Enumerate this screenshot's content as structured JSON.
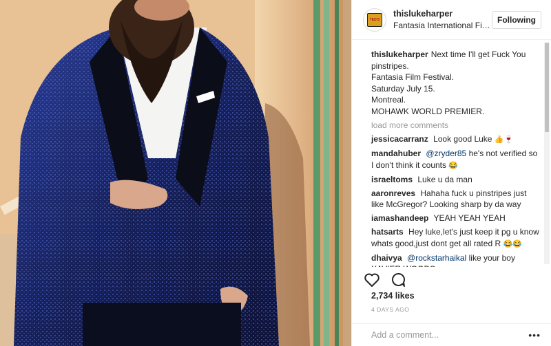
{
  "header": {
    "username": "thislukeharper",
    "location": "Fantasia International Film Festival",
    "follow_label": "Following",
    "avatar_text": "TED'S"
  },
  "caption": {
    "user": "thislukeharper",
    "lines": [
      "Next time I'll get Fuck You",
      "pinstripes.",
      "Fantasia Film Festival.",
      "Saturday July 15.",
      "Montreal.",
      "MOHAWK WORLD PREMIER."
    ]
  },
  "load_more": "load more comments",
  "comments": [
    {
      "user": "jessicacarranz",
      "mention": "",
      "text": "Look good Luke",
      "emoji": "👍🍷"
    },
    {
      "user": "mandahuber",
      "mention": "@zryder85",
      "text": "he's not verified so I don't think it counts",
      "emoji": "😂"
    },
    {
      "user": "israeltoms",
      "mention": "",
      "text": "Luke u da man",
      "emoji": ""
    },
    {
      "user": "aaronreves",
      "mention": "",
      "text": "Hahaha fuck u pinstripes just like McGregor? Looking sharp by da way",
      "emoji": ""
    },
    {
      "user": "iamashandeep",
      "mention": "",
      "text": "YEAH YEAH YEAH",
      "emoji": ""
    },
    {
      "user": "hatsarts",
      "mention": "",
      "text": "Hey luke,let's just keep it pg u know whats good,just dont get all rated R",
      "emoji": "😂😂"
    },
    {
      "user": "dhaivya",
      "mention": "@rockstarhaikal",
      "text": "like your boy XAVIER WOODS..",
      "emoji": ""
    }
  ],
  "likes": "2,734 likes",
  "time_ago": "4 DAYS AGO",
  "add_comment": {
    "placeholder": "Add a comment..."
  },
  "more_options": "•••",
  "icons": {
    "like": "heart-icon",
    "comment": "comment-bubble-icon",
    "more": "more-options-icon"
  },
  "colors": {
    "link": "#003569",
    "muted": "#999999",
    "border": "#efefef",
    "suit": "#1c2a6e"
  }
}
